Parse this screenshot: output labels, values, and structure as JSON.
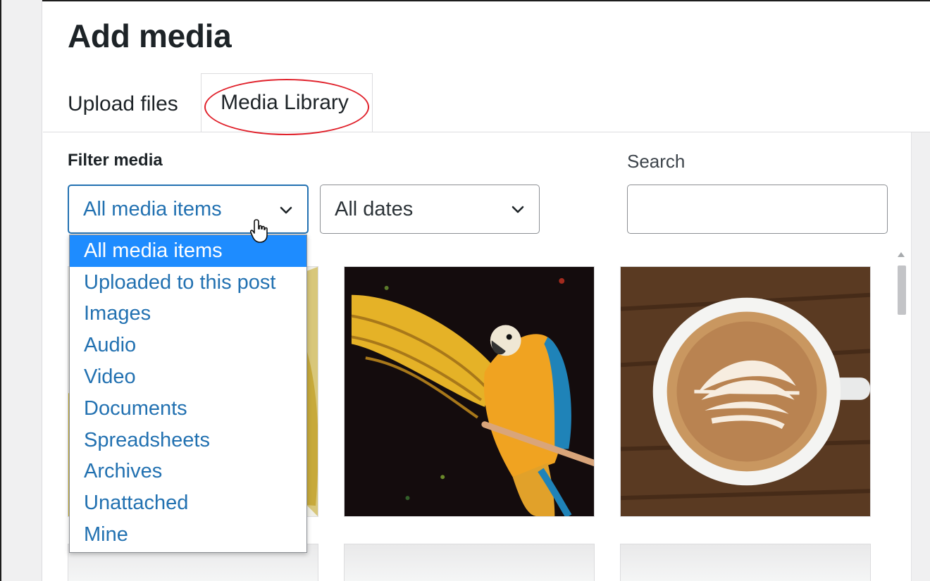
{
  "window": {
    "title": "Add media"
  },
  "tabs": [
    {
      "label": "Upload files",
      "active": false
    },
    {
      "label": "Media Library",
      "active": true
    }
  ],
  "filters": {
    "label": "Filter media",
    "type_select": {
      "value": "All media items",
      "options": [
        "All media items",
        "Uploaded to this post",
        "Images",
        "Audio",
        "Video",
        "Documents",
        "Spreadsheets",
        "Archives",
        "Unattached",
        "Mine"
      ],
      "highlighted": "All media items"
    },
    "date_select": {
      "value": "All dates"
    }
  },
  "search": {
    "label": "Search",
    "value": ""
  },
  "media_grid": {
    "items": [
      {
        "icon": "bananas-image",
        "description_shown": false
      },
      {
        "icon": "parrot-image",
        "description_shown": false
      },
      {
        "icon": "latte-image",
        "description_shown": false
      }
    ]
  },
  "colors": {
    "accent": "#2271b1",
    "selected_option_bg": "#1e8cff",
    "annotation_circle": "#e0202a",
    "text": "#1d2327"
  },
  "icons": {
    "chevron": "chevron-down-icon",
    "cursor": "hand-pointer-icon"
  }
}
